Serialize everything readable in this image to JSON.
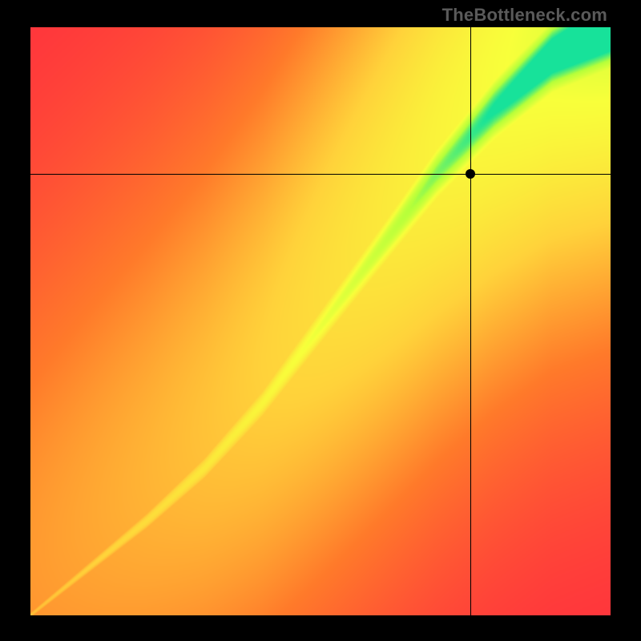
{
  "watermark": "TheBottleneck.com",
  "colors": {
    "background": "#000000",
    "crosshair": "#000000",
    "marker": "#000000",
    "watermark": "#5a5a5a"
  },
  "chart_data": {
    "type": "heatmap",
    "title": "",
    "xlabel": "",
    "ylabel": "",
    "xlim": [
      0,
      100
    ],
    "ylim": [
      0,
      100
    ],
    "grid": false,
    "legend": false,
    "color_scale": [
      {
        "value": 0.0,
        "color": "#ff2a3f"
      },
      {
        "value": 0.35,
        "color": "#ff7a2a"
      },
      {
        "value": 0.6,
        "color": "#ffd23a"
      },
      {
        "value": 0.8,
        "color": "#f8ff3a"
      },
      {
        "value": 0.92,
        "color": "#b6ff3a"
      },
      {
        "value": 1.0,
        "color": "#17e29a"
      }
    ],
    "ridge": {
      "points": [
        {
          "x": 0,
          "y": 0
        },
        {
          "x": 10,
          "y": 8
        },
        {
          "x": 20,
          "y": 16
        },
        {
          "x": 30,
          "y": 25
        },
        {
          "x": 40,
          "y": 36
        },
        {
          "x": 50,
          "y": 49
        },
        {
          "x": 60,
          "y": 62
        },
        {
          "x": 70,
          "y": 75
        },
        {
          "x": 80,
          "y": 86
        },
        {
          "x": 90,
          "y": 95
        },
        {
          "x": 100,
          "y": 100
        }
      ],
      "width_profile": [
        {
          "x": 0,
          "width": 1
        },
        {
          "x": 20,
          "width": 3
        },
        {
          "x": 40,
          "width": 5
        },
        {
          "x": 60,
          "width": 8
        },
        {
          "x": 80,
          "width": 12
        },
        {
          "x": 100,
          "width": 16
        }
      ]
    },
    "crosshair": {
      "x": 76,
      "y": 75
    },
    "marker": {
      "x": 76,
      "y": 75
    }
  }
}
